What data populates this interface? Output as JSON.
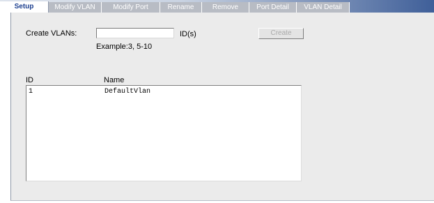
{
  "tabs": [
    {
      "label": "Setup",
      "active": true
    },
    {
      "label": "Modify VLAN",
      "active": false
    },
    {
      "label": "Modify Port",
      "active": false
    },
    {
      "label": "Rename",
      "active": false
    },
    {
      "label": "Remove",
      "active": false
    },
    {
      "label": "Port Detail",
      "active": false
    },
    {
      "label": "VLAN Detail",
      "active": false
    }
  ],
  "form": {
    "create_label": "Create VLANs:",
    "input_value": "",
    "input_placeholder": "",
    "id_suffix": "ID(s)",
    "example": "Example:3, 5-10",
    "create_button": "Create"
  },
  "vlan_table": {
    "columns": [
      "ID",
      "Name"
    ],
    "rows": [
      {
        "id": "1",
        "name": "DefaultVlan"
      }
    ]
  },
  "colors": {
    "active_tab_text": "#1c3f8f",
    "panel_background": "#ebebeb",
    "disabled_button_text": "#a9a9a9"
  }
}
